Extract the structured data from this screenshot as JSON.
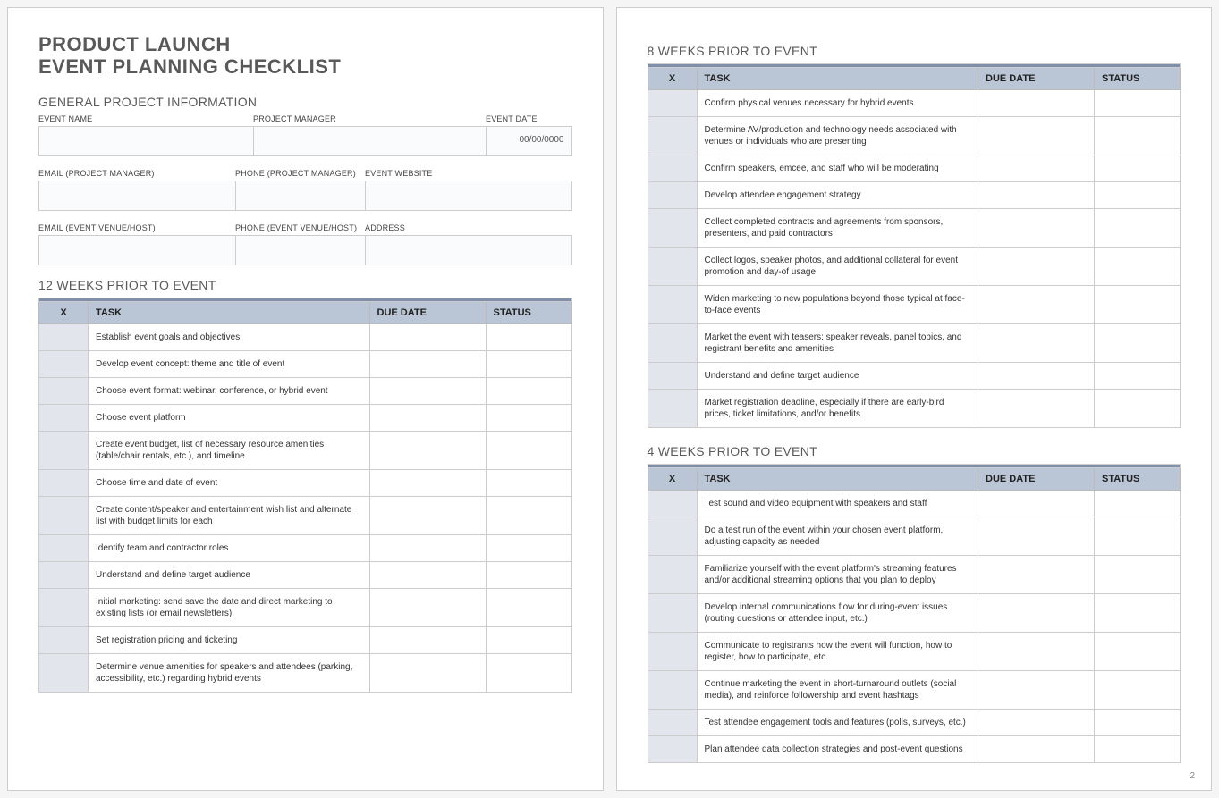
{
  "title_line1": "PRODUCT LAUNCH",
  "title_line2": "EVENT PLANNING CHECKLIST",
  "general_heading": "GENERAL PROJECT INFORMATION",
  "labels": {
    "event_name": "EVENT NAME",
    "project_manager": "PROJECT MANAGER",
    "event_date": "EVENT DATE",
    "email_pm": "EMAIL (PROJECT MANAGER)",
    "phone_pm": "PHONE (PROJECT MANAGER)",
    "event_website": "EVENT WEBSITE",
    "email_venue": "EMAIL (EVENT VENUE/HOST)",
    "phone_venue": "PHONE (EVENT VENUE/HOST)",
    "address": "ADDRESS"
  },
  "values": {
    "event_name": "",
    "project_manager": "",
    "event_date": "00/00/0000",
    "email_pm": "",
    "phone_pm": "",
    "event_website": "",
    "email_venue": "",
    "phone_venue": "",
    "address": ""
  },
  "table_headers": {
    "x": "X",
    "task": "TASK",
    "due": "DUE DATE",
    "status": "STATUS"
  },
  "sections": {
    "w12": {
      "heading": "12 WEEKS PRIOR TO EVENT",
      "tasks": [
        "Establish event goals and objectives",
        "Develop event concept: theme and title of event",
        "Choose event format: webinar, conference, or hybrid event",
        "Choose event platform",
        "Create event budget, list of necessary resource amenities (table/chair rentals, etc.), and timeline",
        "Choose time and date of event",
        "Create content/speaker and entertainment wish list and alternate list with budget limits for each",
        "Identify team and contractor roles",
        "Understand and define target audience",
        "Initial marketing: send save the date and direct marketing to existing lists (or email newsletters)",
        "Set registration pricing and ticketing",
        "Determine venue amenities for speakers and attendees (parking, accessibility, etc.) regarding hybrid events"
      ]
    },
    "w8": {
      "heading": "8 WEEKS PRIOR TO EVENT",
      "tasks": [
        "Confirm physical venues necessary for hybrid events",
        "Determine AV/production and technology needs associated with venues or individuals who are presenting",
        "Confirm speakers, emcee, and staff who will be moderating",
        "Develop attendee engagement strategy",
        "Collect completed contracts and agreements from sponsors, presenters, and paid contractors",
        "Collect logos, speaker photos, and additional collateral for event promotion and day-of usage",
        "Widen marketing to new populations beyond those typical at face-to-face events",
        "Market the event with teasers: speaker reveals, panel topics, and registrant benefits and amenities",
        "Understand and define target audience",
        "Market registration deadline, especially if there are early-bird prices, ticket limitations, and/or benefits"
      ]
    },
    "w4": {
      "heading": "4 WEEKS PRIOR TO EVENT",
      "tasks": [
        "Test sound and video equipment with speakers and staff",
        "Do a test run of the event within your chosen event platform, adjusting capacity as needed",
        "Familiarize yourself with the event platform's streaming features and/or additional streaming options that you plan to deploy",
        "Develop internal communications flow for during-event issues (routing questions or attendee input, etc.)",
        "Communicate to registrants how the event will function, how to register, how to participate, etc.",
        "Continue marketing the event in short-turnaround outlets (social media), and reinforce followership and event hashtags",
        "Test attendee engagement tools and features (polls, surveys, etc.)",
        "Plan attendee data collection strategies and post-event questions"
      ]
    }
  },
  "page_number": "2"
}
